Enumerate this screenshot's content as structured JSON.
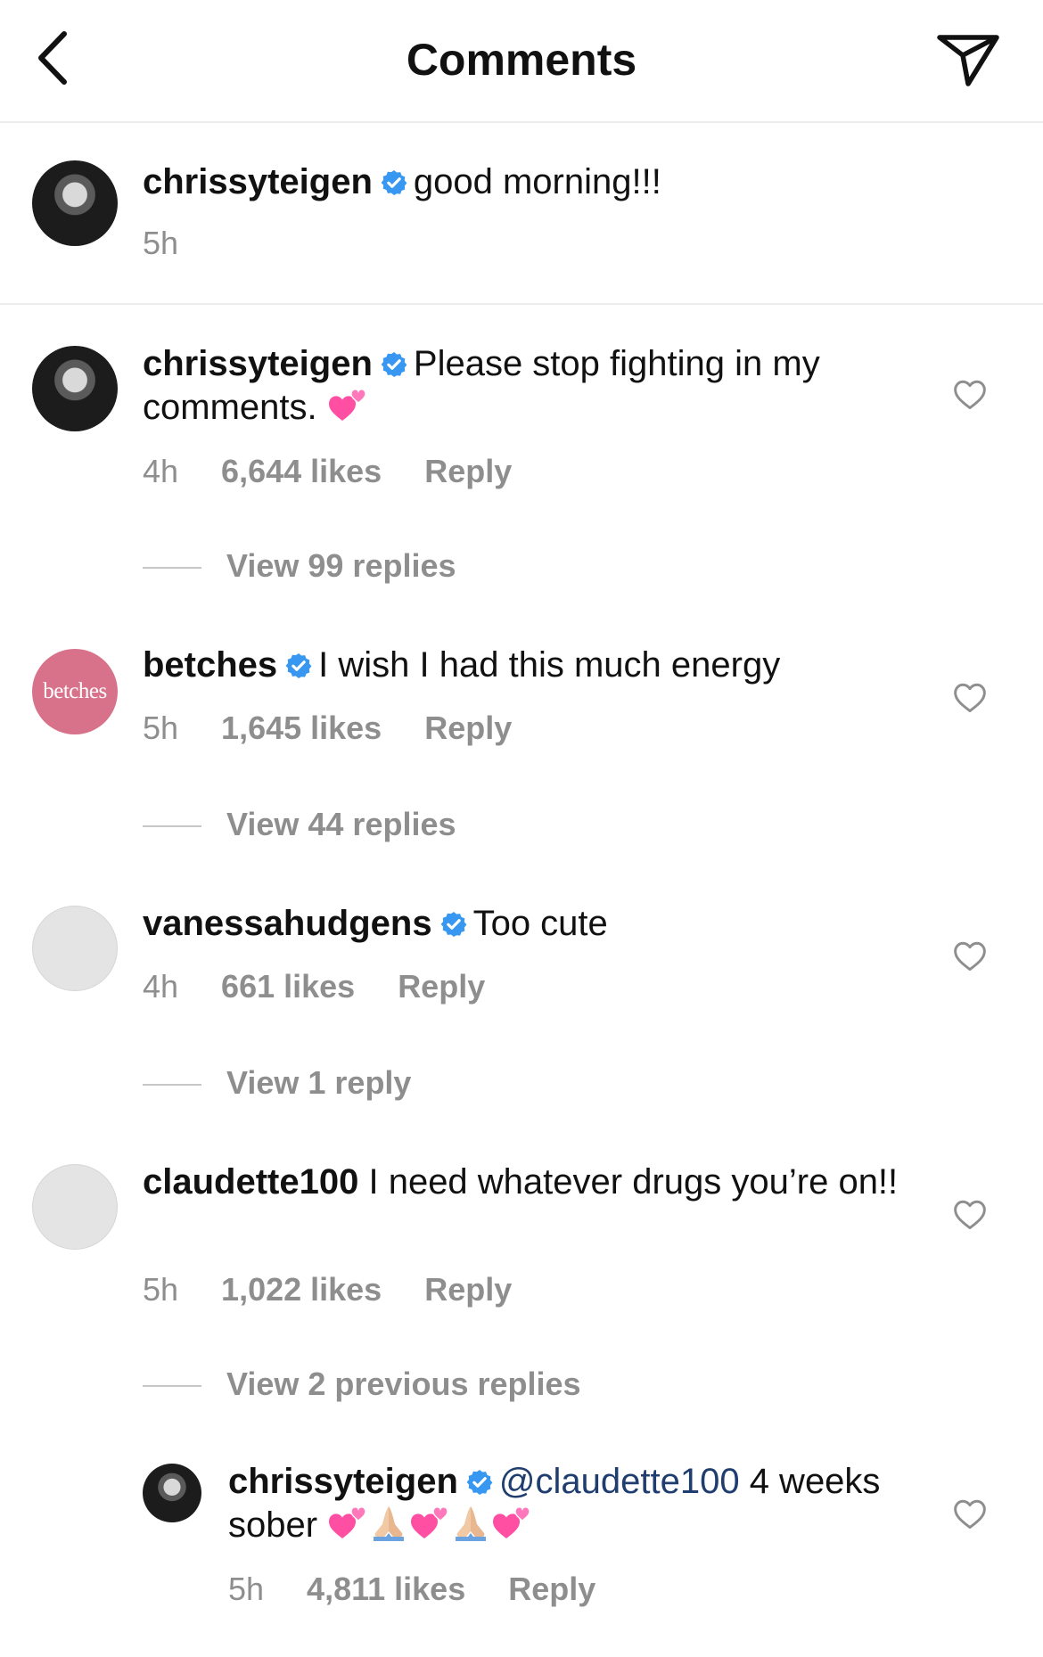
{
  "header": {
    "title": "Comments"
  },
  "caption": {
    "username": "chrissyteigen",
    "text": "good morning!!!",
    "time": "5h"
  },
  "comments": [
    {
      "username": "chrissyteigen",
      "text": "Please stop fighting in my comments.",
      "time": "4h",
      "likes": "6,644 likes",
      "reply": "Reply",
      "view_replies": "View 99 replies"
    },
    {
      "username": "betches",
      "avatar_text": "betches",
      "text": "I wish I had this much energy",
      "time": "5h",
      "likes": "1,645 likes",
      "reply": "Reply",
      "view_replies": "View 44 replies"
    },
    {
      "username": "vanessahudgens",
      "text": "Too cute",
      "time": "4h",
      "likes": "661 likes",
      "reply": "Reply",
      "view_replies": "View 1 reply"
    },
    {
      "username": "claudette100",
      "text": "I need whatever drugs you’re on!!",
      "time": "5h",
      "likes": "1,022 likes",
      "reply": "Reply",
      "view_replies": "View 2 previous replies"
    }
  ],
  "reply": {
    "username": "chrissyteigen",
    "mention": "@claudette100",
    "text_after_mention": " 4 weeks sober",
    "time": "5h",
    "likes": "4,811 likes",
    "reply": "Reply"
  },
  "colors": {
    "verified": "#3897f0",
    "secondary_text": "#8e8e8e",
    "mention": "#1f3d6e",
    "betches_avatar": "#d8728b",
    "heart_emoji": "#ff4fa3"
  },
  "icons": [
    "back-chevron-icon",
    "send-icon",
    "verified-badge-icon",
    "heart-icon",
    "pink-hearts-emoji",
    "folded-hands-emoji"
  ]
}
